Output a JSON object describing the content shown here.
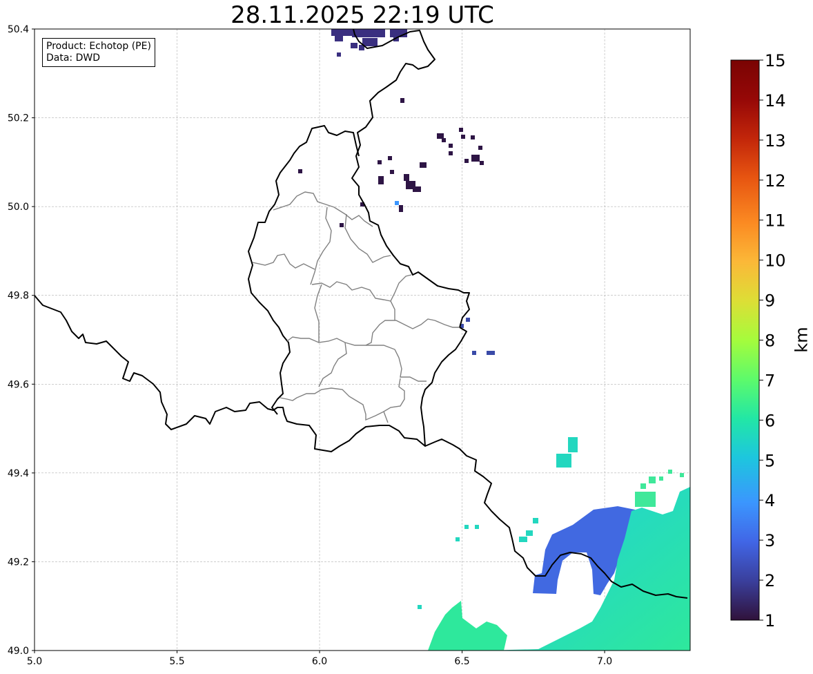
{
  "title": "28.11.2025 22:19 UTC",
  "info": {
    "product": "Product: Echotop (PE)",
    "data": "Data: DWD"
  },
  "colorbar": {
    "unit": "km",
    "ticks": [
      "1",
      "2",
      "3",
      "4",
      "5",
      "6",
      "7",
      "8",
      "9",
      "10",
      "11",
      "12",
      "13",
      "14",
      "15"
    ],
    "colors": [
      "#30123b",
      "#3a3f9c",
      "#4166e6",
      "#3b96fe",
      "#1dc6de",
      "#22e7a5",
      "#5dfa6b",
      "#a5fc3c",
      "#ddde36",
      "#fbb838",
      "#fb8a22",
      "#e75511",
      "#c2260a",
      "#960807",
      "#7a0403"
    ]
  },
  "map": {
    "xlim": [
      5.0,
      7.3
    ],
    "ylim": [
      49.0,
      50.4
    ],
    "xticks": [
      "5.0",
      "5.5",
      "6.0",
      "6.5",
      "7.0"
    ],
    "yticks": [
      "49.0",
      "49.2",
      "49.4",
      "49.6",
      "49.8",
      "50.0",
      "50.2",
      "50.4"
    ],
    "grid": true
  }
}
